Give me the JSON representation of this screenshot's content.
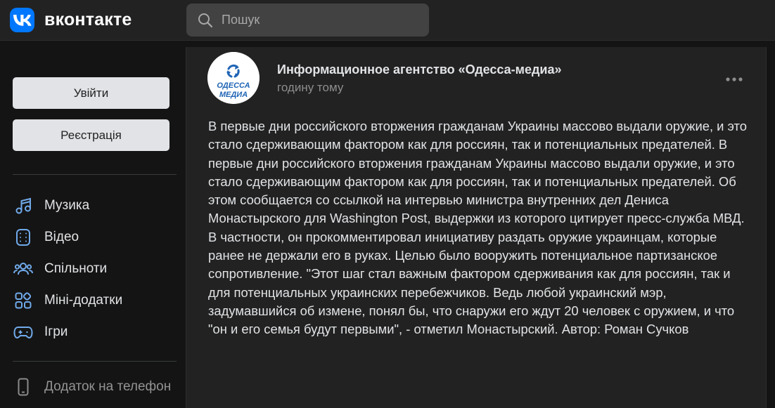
{
  "header": {
    "logo_text": "вконтакте",
    "search_placeholder": "Пошук"
  },
  "sidebar": {
    "login_label": "Увійти",
    "register_label": "Реєстрація",
    "items": [
      {
        "label": "Музика",
        "icon": "music-icon"
      },
      {
        "label": "Відео",
        "icon": "video-icon"
      },
      {
        "label": "Спільноти",
        "icon": "communities-icon"
      },
      {
        "label": "Міні-додатки",
        "icon": "mini-apps-icon"
      },
      {
        "label": "Ігри",
        "icon": "games-icon"
      }
    ],
    "phone_app_label": "Додаток на телефон"
  },
  "post": {
    "author": "Информационное агентство «Одесса-медиа»",
    "time": "годину тому",
    "avatar_text_top": "ОДЕССА",
    "avatar_text_bottom": "МЕДИА",
    "text": "В первые дни российского вторжения гражданам Украины массово выдали оружие, и это стало сдерживающим фактором как для россиян, так и потенциальных предателей. В первые дни российского вторжения гражданам Украины массово выдали оружие, и это стало сдерживающим фактором как для россиян, так и потенциальных предателей. Об этом сообщается со ссылкой на интервью министра внутренних дел Дениса Монастырского для Washington Post, выдержки из которого цитирует пресс-служба МВД. В частности, он прокомментировал инициативу раздать оружие украинцам, которые ранее не держали его в руках. Целью было вооружить потенциальное партизанское сопротивление. \"Этот шаг стал важным фактором сдерживания как для россиян, так и для потенциальных украинских перебежчиков. Ведь любой украинский мэр, задумавшийся об измене, понял бы, что снаружи его ждут 20 человек с оружием, и что \"он и его семья будут первыми\", - отметил Монастырский. Автор: Роман Сучков"
  },
  "colors": {
    "accent": "#0077ff",
    "icon_blue": "#71aaeb",
    "background": "#141414",
    "panel": "#222222"
  }
}
